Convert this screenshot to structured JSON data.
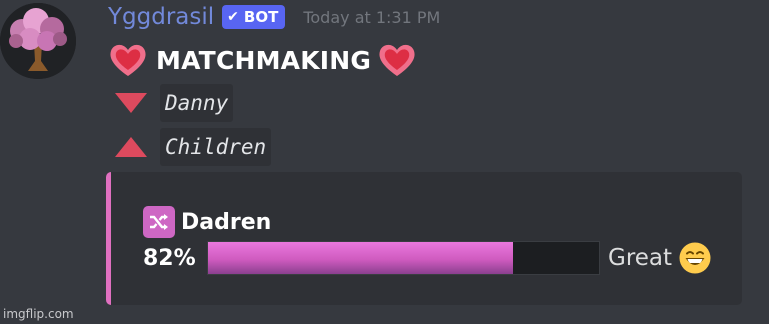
{
  "message": {
    "author": "Yggdrasil",
    "bot_badge": "BOT",
    "timestamp": "Today at 1:31 PM",
    "title": "MATCHMAKING",
    "names": [
      "Danny",
      "Children"
    ],
    "icons": {
      "avatar": "pink-tree-icon",
      "title_left": "heart-icon",
      "title_right": "heart-icon",
      "name_1": "triangle-down-icon",
      "name_2": "triangle-up-icon"
    }
  },
  "embed": {
    "accent_color": "#e070c0",
    "author_icon": "shuffle-icon",
    "author": "Dadren",
    "percent_text": "82%",
    "progress": 0.78,
    "rating": "Great",
    "rating_emoji": "grinning-face-icon"
  },
  "watermark": "imgflip.com",
  "colors": {
    "background": "#36393f",
    "username": "#7289da",
    "badge": "#5865f2",
    "embed_bg": "#2f3136"
  }
}
